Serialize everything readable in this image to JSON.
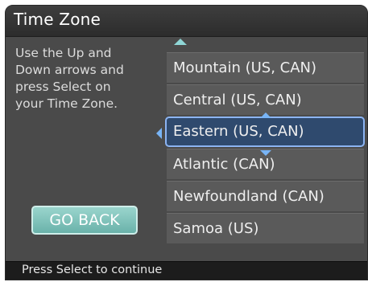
{
  "header": {
    "title": "Time Zone"
  },
  "instructions": {
    "line1": "Use the Up and",
    "line2": "Down arrows and",
    "line3": "press Select on",
    "line4": "your Time Zone."
  },
  "buttons": {
    "go_back_label": "GO BACK"
  },
  "timezone_list": {
    "items": [
      {
        "label": "Mountain (US, CAN)",
        "selected": false
      },
      {
        "label": "Central (US, CAN)",
        "selected": false
      },
      {
        "label": "Eastern (US, CAN)",
        "selected": true
      },
      {
        "label": "Atlantic (CAN)",
        "selected": false
      },
      {
        "label": "Newfoundland (CAN)",
        "selected": false
      },
      {
        "label": "Samoa (US)",
        "selected": false
      }
    ]
  },
  "footer": {
    "hint": "Press Select to continue"
  },
  "colors": {
    "selection_border": "#8cb4f2",
    "button_teal": "#6ab2aa",
    "scroll_arrow": "#8fd6d6"
  },
  "icons": {
    "scroll_up": "triangle-up-icon",
    "selection_up": "triangle-up-icon",
    "selection_down": "triangle-down-icon",
    "selection_left": "triangle-left-icon"
  }
}
